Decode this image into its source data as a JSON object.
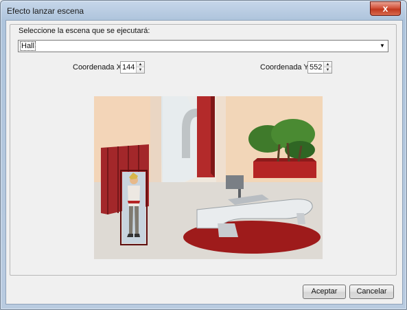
{
  "window": {
    "title": "Efecto lanzar escena",
    "close_label": "x"
  },
  "scene_group": {
    "label": "Seleccione la escena que se ejecutará:",
    "selected": "Hall"
  },
  "coord_x": {
    "label": "Coordenada X",
    "value": "144"
  },
  "coord_y": {
    "label": "Coordenada Y",
    "value": "552"
  },
  "buttons": {
    "accept": "Aceptar",
    "cancel": "Cancelar"
  },
  "colors": {
    "window_frame": "#b9cbe0",
    "client_bg": "#f0f0f0",
    "close_button": "#c0391f",
    "carpet": "#9e1b1b"
  }
}
